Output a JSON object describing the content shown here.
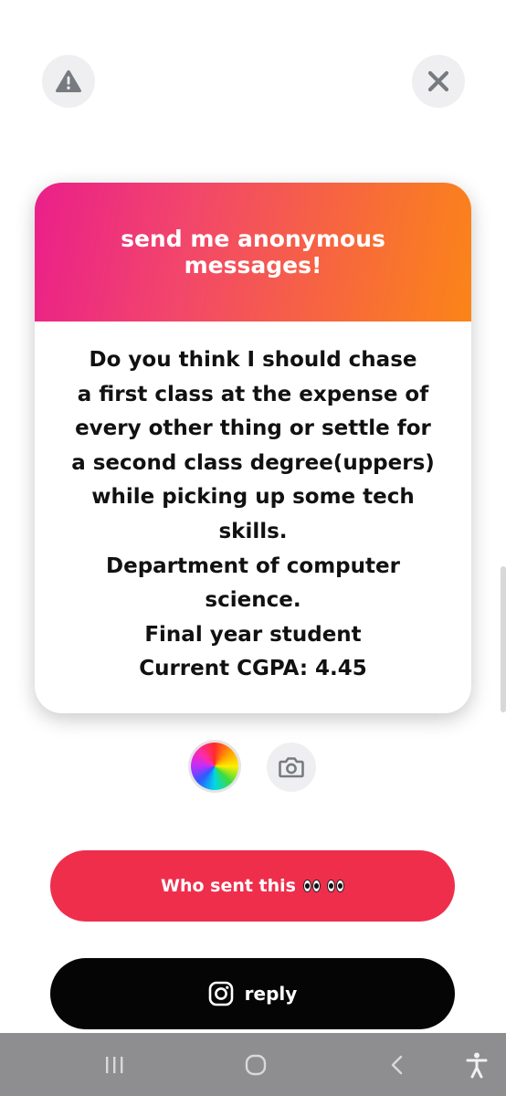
{
  "header": {
    "report_icon": "warning-triangle-icon",
    "close_icon": "close-x-icon"
  },
  "card": {
    "title": "send me anonymous messages!",
    "message_lines": [
      "Do you think I should chase",
      "a first class at the expense of",
      "every other thing or settle for",
      "a second class degree(uppers)",
      "while picking up some tech",
      "skills.",
      "Department of computer",
      "science.",
      "Final year student",
      "Current CGPA: 4.45"
    ],
    "gradient_colors": [
      "#ea1f8a",
      "#fb8518"
    ]
  },
  "tools": {
    "color_icon": "color-wheel-icon",
    "camera_icon": "camera-icon"
  },
  "actions": {
    "who_sent_label": "Who sent this",
    "who_sent_emoji": "eyes-emoji",
    "who_sent_color": "#ef2e4c",
    "reply_label": "reply",
    "reply_icon": "instagram-icon",
    "reply_color": "#050505"
  },
  "system_nav": {
    "recents_icon": "recents-icon",
    "home_icon": "home-icon",
    "back_icon": "back-icon",
    "accessibility_icon": "accessibility-icon"
  }
}
